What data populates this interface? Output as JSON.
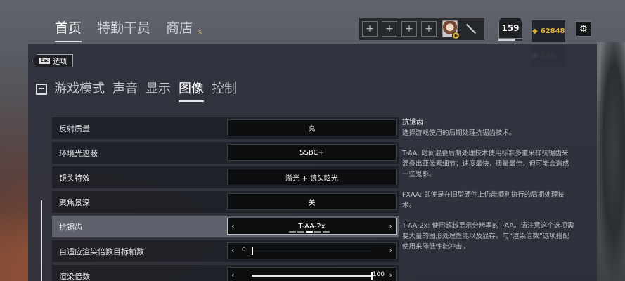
{
  "topnav": {
    "items": [
      {
        "label": "首页",
        "active": true
      },
      {
        "label": "特勤干员",
        "active": false
      },
      {
        "label": "商店",
        "active": false
      }
    ],
    "shop_badge": "%"
  },
  "loadout": {
    "slot_symbol": "+",
    "avatar_badge": "6"
  },
  "player": {
    "level": "159",
    "level_progress": 0.7,
    "coins": "62848",
    "credits": "138"
  },
  "back": {
    "key": "Esc",
    "label": "选项"
  },
  "tabs": [
    {
      "label": "游戏模式",
      "active": false
    },
    {
      "label": "声音",
      "active": false
    },
    {
      "label": "显示",
      "active": false
    },
    {
      "label": "图像",
      "active": true
    },
    {
      "label": "控制",
      "active": false
    }
  ],
  "settings": [
    {
      "label": "反射质量",
      "value": "高"
    },
    {
      "label": "环境光遮蔽",
      "value": "SSBC+"
    },
    {
      "label": "镜头特效",
      "value": "溢光 + 镜头眩光"
    },
    {
      "label": "聚焦景深",
      "value": "关"
    },
    {
      "label": "抗锯齿",
      "value": "T-AA-2x",
      "selected_index": 2,
      "option_count": 5
    },
    {
      "label": "自适应渲染倍数目标帧数",
      "value": "0",
      "fraction": 0.0
    },
    {
      "label": "渲染倍数",
      "value": "100",
      "fraction": 1.0
    }
  ],
  "description": {
    "title": "抗锯齿",
    "intro": "选择游戏使用的后期处理抗锯齿技术。",
    "taa": "T-AA: 时间混叠后期处理技术使用标准多重采样抗锯齿来混叠出亚像素细节；速度最快，质量最佳，但可能会造成一些鬼影。",
    "fxaa": "FXAA: 即使是在旧型硬件上仍能顺利执行的后期处理技术。",
    "taa2x": "T-AA-2x: 使用超越显示分辨率的T-AA。请注意这个选项需要大量的图形处理性能以及显存。与“渲染倍数”选项搭配使用来降低性能冲击。"
  },
  "colors": {
    "accent": "#e2b43c",
    "panel": "#2e313c",
    "row": "#1d1f26",
    "row_active": "#60646e"
  }
}
